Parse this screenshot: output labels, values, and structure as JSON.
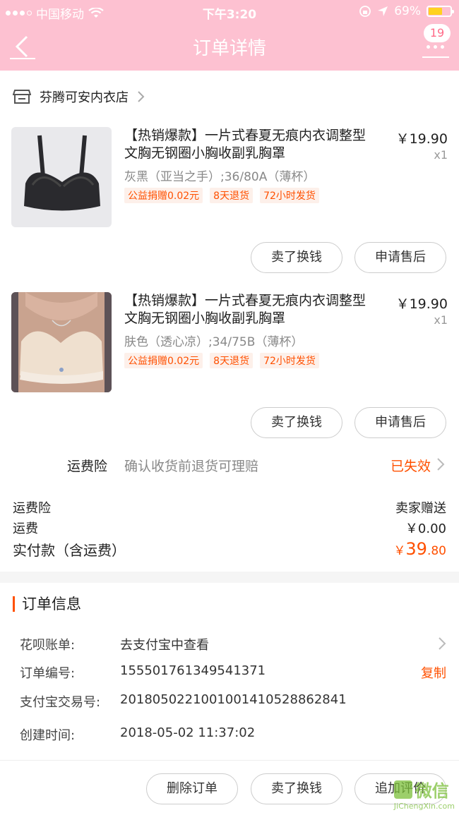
{
  "status_bar": {
    "carrier": "中国移动",
    "time": "下午3:20",
    "battery": "69%",
    "battery_level": 0.69
  },
  "nav": {
    "title": "订单详情",
    "badge": "19"
  },
  "shop": {
    "name": "芬腾可安内衣店"
  },
  "items": [
    {
      "title": "【热销爆款】一片式春夏无痕内衣调整型文胸无钢圈小胸收副乳胸罩",
      "sku": "灰黑（亚当之手）;36/80A（薄杯）",
      "tags": [
        "公益捐赠0.02元",
        "8天退货",
        "72小时发货"
      ],
      "price": "￥19.90",
      "qty": "x1",
      "btn_sell": "卖了换钱",
      "btn_after": "申请售后"
    },
    {
      "title": "【热销爆款】一片式春夏无痕内衣调整型文胸无钢圈小胸收副乳胸罩",
      "sku": "肤色（透心凉）;34/75B（薄杯）",
      "tags": [
        "公益捐赠0.02元",
        "8天退货",
        "72小时发货"
      ],
      "price": "￥19.90",
      "qty": "x1",
      "btn_sell": "卖了换钱",
      "btn_after": "申请售后"
    }
  ],
  "insurance": {
    "label": "运费险",
    "desc": "确认收货前退货可理赔",
    "status": "已失效"
  },
  "summary": {
    "ins_label": "运费险",
    "ins_value": "卖家赠送",
    "ship_label": "运费",
    "ship_value": "￥0.00",
    "paid_label": "实付款（含运费）",
    "paid_currency": "￥",
    "paid_int": "39",
    "paid_dec": ".80"
  },
  "order_info": {
    "title": "订单信息",
    "rows": [
      {
        "label": "花呗账单:",
        "value": "去支付宝中查看"
      },
      {
        "label": "订单编号:",
        "value": "155501761349541371",
        "action": "复制"
      },
      {
        "label": "支付宝交易号:",
        "value": "2018050221001001410528862841"
      },
      {
        "label": "创建时间:",
        "value": "2018-05-02 11:37:02"
      }
    ]
  },
  "footer": {
    "delete": "删除订单",
    "sell": "卖了换钱",
    "review": "追加评价"
  },
  "watermark": {
    "text1": "微信",
    "text2": "JiChengXin.com"
  },
  "colors": {
    "header": "#fdc1d1",
    "accent": "#ff5000"
  }
}
